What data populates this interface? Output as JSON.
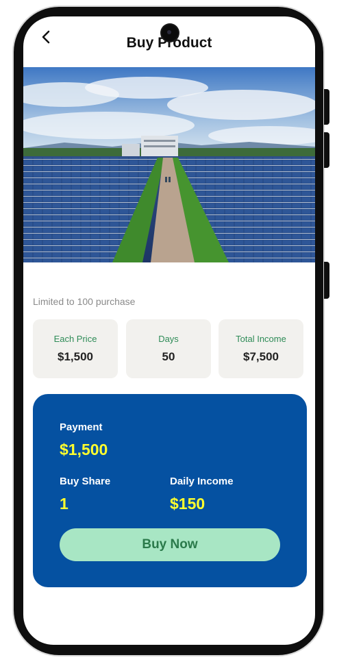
{
  "header": {
    "title": "Buy Product",
    "back_icon": "chevron-left-icon"
  },
  "product": {
    "image": "solar-panel-farm-photo",
    "limit_text": "Limited to 100 purchase"
  },
  "stats": [
    {
      "label": "Each Price",
      "value": "$1,500"
    },
    {
      "label": "Days",
      "value": "50"
    },
    {
      "label": "Total Income",
      "value": "$7,500"
    }
  ],
  "payment_card": {
    "payment_label": "Payment",
    "payment_value": "$1,500",
    "share_label": "Buy Share",
    "share_value": "1",
    "daily_label": "Daily Income",
    "daily_value": "$150",
    "buy_button": "Buy Now"
  },
  "colors": {
    "card_bg": "#0551a1",
    "highlight": "#ffff2e",
    "button_bg": "#a8e6c4",
    "button_text": "#2b7a4b",
    "stat_label": "#2e8b57",
    "stat_bg": "#f2f1ee"
  }
}
